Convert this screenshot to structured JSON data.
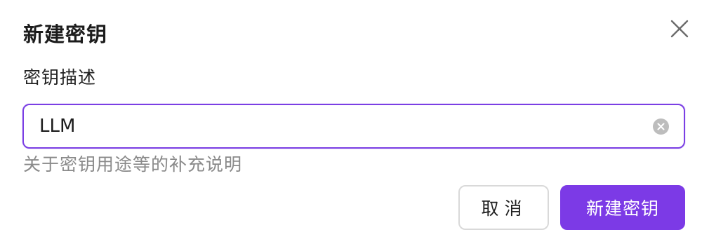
{
  "dialog": {
    "title": "新建密钥",
    "close_icon": "close-icon"
  },
  "field": {
    "label": "密钥描述",
    "value": "LLM",
    "clear_icon": "clear-circle-icon",
    "help_text": "关于密钥用途等的补充说明"
  },
  "actions": {
    "cancel_label": "取消",
    "confirm_label": "新建密钥"
  },
  "colors": {
    "accent": "#7c3ae6",
    "focus_border": "#7b3fe4",
    "help_text": "#8a8a8a"
  }
}
